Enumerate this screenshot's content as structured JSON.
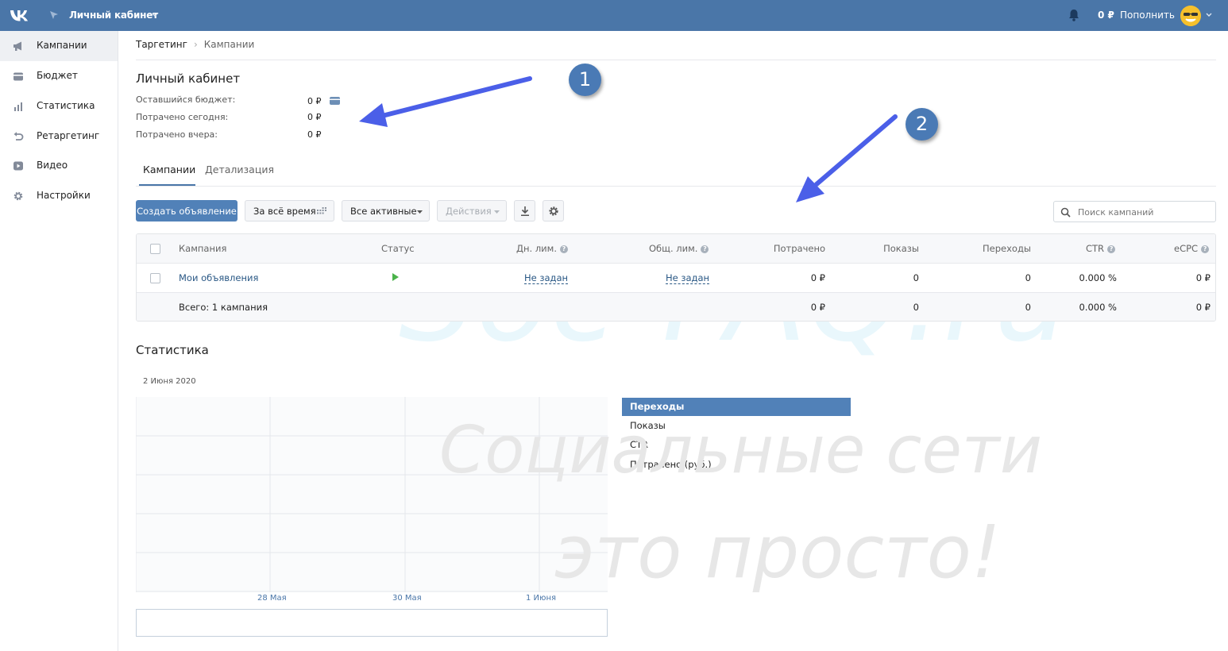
{
  "topbar": {
    "cabinet_title": "Личный кабинет",
    "balance": "0 ₽",
    "topup_label": "Пополнить",
    "accent_color": "#4a76a8"
  },
  "sidebar": {
    "items": [
      {
        "label": "Кампании",
        "icon": "megaphone-icon",
        "active": true
      },
      {
        "label": "Бюджет",
        "icon": "wallet-icon"
      },
      {
        "label": "Статистика",
        "icon": "bar-chart-icon"
      },
      {
        "label": "Ретаргетинг",
        "icon": "undo-arrow-icon"
      },
      {
        "label": "Видео",
        "icon": "play-icon"
      },
      {
        "label": "Настройки",
        "icon": "gear-icon"
      }
    ]
  },
  "breadcrumb": {
    "root": "Таргетинг",
    "current": "Кампании"
  },
  "account": {
    "title": "Личный кабинет",
    "rows": [
      {
        "label": "Оставшийся бюджет:",
        "value": "0 ₽"
      },
      {
        "label": "Потрачено сегодня:",
        "value": "0 ₽"
      },
      {
        "label": "Потрачено вчера:",
        "value": "0 ₽"
      }
    ]
  },
  "tabs": [
    {
      "label": "Кампании",
      "active": true
    },
    {
      "label": "Детализация",
      "active": false
    }
  ],
  "toolbar": {
    "create_label": "Создать объявление",
    "period_label": "За всё время",
    "filter_label": "Все активные",
    "actions_label": "Действия",
    "search_placeholder": "Поиск кампаний"
  },
  "table": {
    "headers": {
      "campaign": "Кампания",
      "status": "Статус",
      "day_limit": "Дн. лим.",
      "total_limit": "Общ. лим.",
      "spent": "Потрачено",
      "impressions": "Показы",
      "clicks": "Переходы",
      "ctr": "CTR",
      "ecpc": "eCPC"
    },
    "rows": [
      {
        "campaign": "Мои объявления",
        "status": "running",
        "day_limit": "Не задан",
        "total_limit": "Не задан",
        "spent": "0 ₽",
        "impressions": "0",
        "clicks": "0",
        "ctr": "0.000 %",
        "ecpc": "0 ₽"
      }
    ],
    "total": {
      "label": "Всего: 1 кампания",
      "spent": "0 ₽",
      "impressions": "0",
      "clicks": "0",
      "ctr": "0.000 %",
      "ecpc": "0 ₽"
    }
  },
  "statistics": {
    "title": "Статистика",
    "date": "2 Июня 2020",
    "x_labels": [
      "28 Мая",
      "30 Мая",
      "1 Июня"
    ],
    "metrics": [
      {
        "label": "Переходы",
        "selected": true
      },
      {
        "label": "Показы",
        "selected": false
      },
      {
        "label": "CTR",
        "selected": false
      },
      {
        "label": "Потрачено (руб.)",
        "selected": false
      }
    ]
  },
  "watermark": {
    "line1": "Soc-FAQ.ru",
    "line2": "Социальные сети",
    "line3": "это просто!"
  },
  "annotations": {
    "badge1": "1",
    "badge2": "2",
    "arrow_color": "#4b5fe8"
  }
}
